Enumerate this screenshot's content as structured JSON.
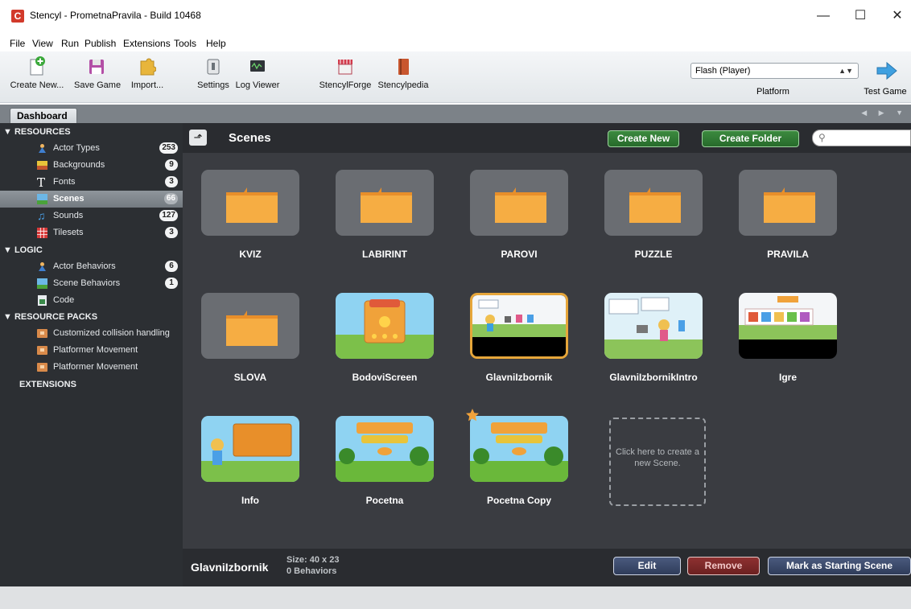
{
  "window": {
    "title": "Stencyl - PrometnaPravila - Build 10468",
    "minimize": "—",
    "maximize": "☐",
    "close": "✕"
  },
  "menu": [
    "File",
    "View",
    "Run",
    "Publish",
    "Extensions",
    "Tools",
    "Help"
  ],
  "toolbar": {
    "create_new": "Create New...",
    "save_game": "Save Game",
    "import": "Import...",
    "settings": "Settings",
    "log_viewer": "Log Viewer",
    "stencylforge": "StencylForge",
    "stencylpedia": "Stencylpedia",
    "platform_value": "Flash (Player)",
    "platform_label": "Platform",
    "test_game": "Test Game"
  },
  "tab": {
    "label": "Dashboard"
  },
  "sidebar": {
    "resources_header": "▼ RESOURCES",
    "resources": [
      {
        "label": "Actor Types",
        "count": "253"
      },
      {
        "label": "Backgrounds",
        "count": "9"
      },
      {
        "label": "Fonts",
        "count": "3"
      },
      {
        "label": "Scenes",
        "count": "66"
      },
      {
        "label": "Sounds",
        "count": "127"
      },
      {
        "label": "Tilesets",
        "count": "3"
      }
    ],
    "logic_header": "▼ LOGIC",
    "logic": [
      {
        "label": "Actor Behaviors",
        "count": "6"
      },
      {
        "label": "Scene Behaviors",
        "count": "1"
      },
      {
        "label": "Code",
        "count": ""
      }
    ],
    "packs_header": "▼ RESOURCE PACKS",
    "packs": [
      {
        "label": "Customized collision handling"
      },
      {
        "label": "Platformer Movement"
      },
      {
        "label": "Platformer Movement"
      }
    ],
    "extensions_header": "EXTENSIONS"
  },
  "main": {
    "title": "Scenes",
    "create_new": "Create New",
    "create_folder": "Create Folder",
    "search_placeholder": "",
    "folders": [
      "KVIZ",
      "LABIRINT",
      "PAROVI",
      "PUZZLE",
      "PRAVILA",
      "SLOVA"
    ],
    "scenes": [
      "BodoviScreen",
      "GlavniIzbornik",
      "GlavniIzbornikIntro",
      "Igre",
      "Info",
      "Pocetna",
      "Pocetna Copy"
    ],
    "new_scene_text": "Click here to create a new Scene."
  },
  "footer": {
    "name": "GlavniIzbornik",
    "size": "Size: 40 x 23",
    "behaviors": "0 Behaviors",
    "edit": "Edit",
    "remove": "Remove",
    "mark_start": "Mark as Starting Scene"
  }
}
